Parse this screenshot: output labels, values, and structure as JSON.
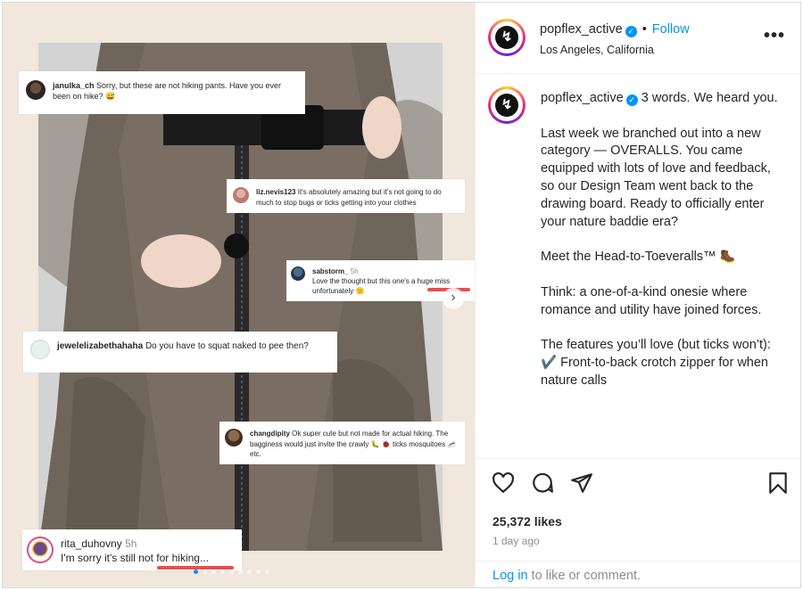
{
  "media": {
    "comments": [
      {
        "user": "janulka_ch",
        "time": "",
        "text": "Sorry, but these are not hiking pants. Have you ever been on hike? 😅"
      },
      {
        "user": "liz.nevis123",
        "time": "",
        "text": "It's absolutely amazing but it's not going to do much to stop bugs or ticks getting into your clothes"
      },
      {
        "user": "sabstorm_",
        "time": "5h",
        "text": "Love the thought but this one's a huge miss unfortunately 😕"
      },
      {
        "user": "jewelelizabethahaha",
        "time": "",
        "text": "Do you have to squat naked to pee then?"
      },
      {
        "user": "changdipity",
        "time": "",
        "text": "Ok super cute but not made for actual hiking. The bagginess would just invite the crawly 🐛 🐞 ticks mosquitoes 🦟 etc."
      },
      {
        "user": "rita_duhovny",
        "time": "5h",
        "text": "I'm sorry it's still not for hiking..."
      }
    ],
    "carousel": {
      "count": 9,
      "active_index": 0
    },
    "next_icon": "chevron-right-icon"
  },
  "header": {
    "username": "popflex_active",
    "verified_icon": "verified-check-icon",
    "separator": "•",
    "follow_label": "Follow",
    "location": "Los Angeles, California",
    "more_icon": "more-horizontal-icon"
  },
  "caption": {
    "username": "popflex_active",
    "first_line": "3 words. We heard you.",
    "paragraphs": [
      "Last week we branched out into a new category — OVERALLS. You came equipped with lots of love and feedback, so our Design Team went back to the drawing board. Ready to officially enter your nature baddie era?",
      "Meet the Head-to-Toeveralls™ 🥾",
      "Think: a one-of-a-kind onesie where romance and utility have joined forces.",
      "The features you’ll love (but ticks won’t):",
      "✔️ Front-to-back crotch zipper for when nature calls"
    ]
  },
  "actions": {
    "icons": [
      "heart-icon",
      "comment-icon",
      "share-icon",
      "bookmark-icon"
    ],
    "likes": "25,372 likes",
    "time_ago": "1 day ago"
  },
  "login": {
    "link_label": "Log in",
    "rest": " to like or comment."
  },
  "colors": {
    "accent": "#0095f6",
    "text": "#262626",
    "muted": "#8e8e8e",
    "highlight": "#ef4b4b"
  }
}
